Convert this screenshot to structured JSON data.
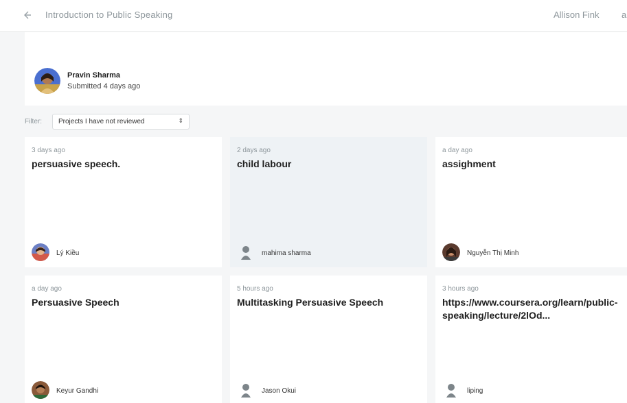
{
  "topbar": {
    "back_icon": "arrow-left-icon",
    "course_title": "Introduction to Public Speaking",
    "user_name": "Allison Fink",
    "user_name_cut": "a"
  },
  "submission": {
    "name": "Pravin Sharma",
    "submitted": "Submitted 4 days ago"
  },
  "filter": {
    "label": "Filter:",
    "selected": "Projects I have not reviewed",
    "caret": "⇕"
  },
  "cards": [
    {
      "time": "3 days ago",
      "title": "persuasive speech.",
      "author": "Lý Kiều",
      "avatar": "photo-avatar"
    },
    {
      "time": "2 days ago",
      "title": "child labour",
      "author": "mahima sharma",
      "avatar": "default-avatar"
    },
    {
      "time": "a day ago",
      "title": "assighment",
      "author": "Nguyễn Thị Minh",
      "avatar": "photo-avatar"
    },
    {
      "time": "a day ago",
      "title": "Persuasive Speech",
      "author": "Keyur Gandhi",
      "avatar": "photo-avatar"
    },
    {
      "time": "5 hours ago",
      "title": "Multitasking Persuasive Speech",
      "author": "Jason Okui",
      "avatar": "default-avatar"
    },
    {
      "time": "3 hours ago",
      "title": "https://www.coursera.org/learn/public-speaking/lecture/2lOd...",
      "author": "liping",
      "avatar": "default-avatar"
    }
  ],
  "colors": {
    "background": "#f5f6f7",
    "card": "#ffffff",
    "card_selected": "#eef2f5",
    "muted_text": "#8d969b"
  }
}
